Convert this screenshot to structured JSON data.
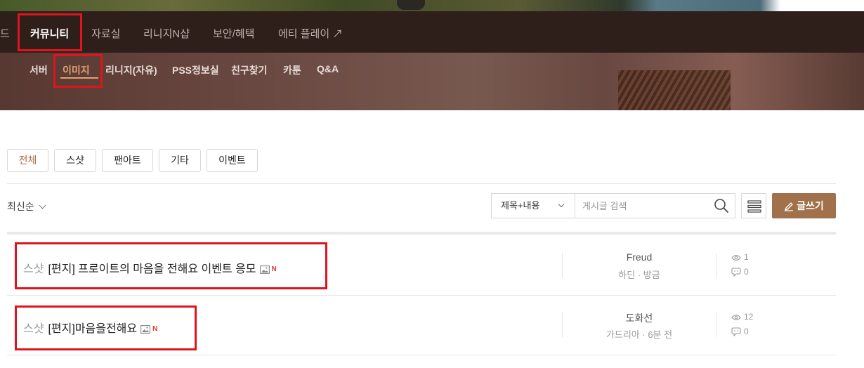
{
  "main_nav": {
    "items": [
      {
        "label": "드"
      },
      {
        "label": "커뮤니티"
      },
      {
        "label": "자료실"
      },
      {
        "label": "리니지N샵"
      },
      {
        "label": "보안/혜택"
      },
      {
        "label": "에티 플레이 ↗"
      }
    ]
  },
  "sub_nav": {
    "items": [
      {
        "label": "서버"
      },
      {
        "label": "이미지"
      },
      {
        "label": "리니지(자유)"
      },
      {
        "label": "PSS정보실"
      },
      {
        "label": "친구찾기"
      },
      {
        "label": "카툰"
      },
      {
        "label": "Q&A"
      }
    ]
  },
  "filter_tabs": [
    {
      "label": "전체"
    },
    {
      "label": "스샷"
    },
    {
      "label": "팬아트"
    },
    {
      "label": "기타"
    },
    {
      "label": "이벤트"
    }
  ],
  "sort": {
    "label": "최신순"
  },
  "search": {
    "scope": "제목+내용",
    "placeholder": "게시글 검색"
  },
  "write_button": {
    "label": "글쓰기"
  },
  "posts": [
    {
      "category": "스샷",
      "title": "[편지] 프로이트의 마음을 전해요 이벤트 응모",
      "new_badge": "N",
      "author": "Freud",
      "server_time": "하딘 · 방금",
      "views": "1",
      "comments": "0"
    },
    {
      "category": "스샷",
      "title": "[편지]마음을전해요",
      "new_badge": "N",
      "author": "도화선",
      "server_time": "가드리아 · 6분 전",
      "views": "12",
      "comments": "0"
    }
  ],
  "colors": {
    "accent": "#a0714a",
    "highlight": "#e0141e",
    "nav_bg": "#2f1f1b",
    "sub_active": "#e6a070",
    "new_badge": "#e53a2a"
  }
}
